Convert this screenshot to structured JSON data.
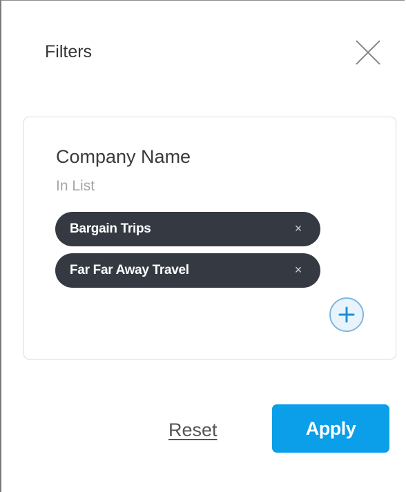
{
  "panel": {
    "title": "Filters",
    "close_icon": "close-icon"
  },
  "filter": {
    "field_name": "Company Name",
    "operator": "In List",
    "values": [
      {
        "label": "Bargain Trips",
        "remove_glyph": "×"
      },
      {
        "label": "Far Far Away Travel",
        "remove_glyph": "×"
      }
    ],
    "add_icon": "plus-circle-icon"
  },
  "actions": {
    "reset_label": "Reset",
    "apply_label": "Apply"
  },
  "colors": {
    "chip_background": "#353a42",
    "apply_background": "#0a9fe8",
    "add_button_accent": "#1a8fd8"
  }
}
